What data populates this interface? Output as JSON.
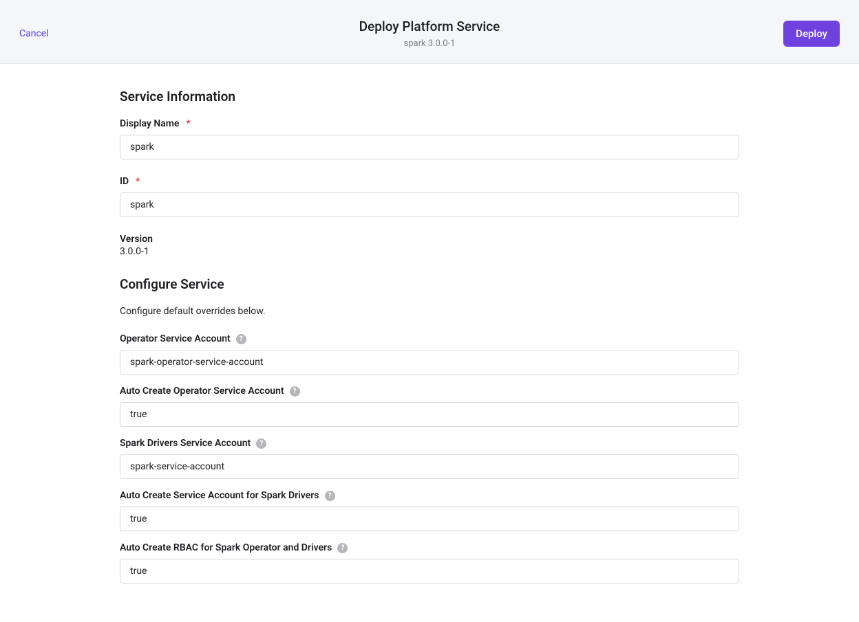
{
  "header": {
    "cancel_label": "Cancel",
    "title": "Deploy Platform Service",
    "subtitle": "spark 3.0.0-1",
    "deploy_label": "Deploy"
  },
  "service_info": {
    "title": "Service Information",
    "display_name": {
      "label": "Display Name",
      "required": "*",
      "value": "spark"
    },
    "id": {
      "label": "ID",
      "required": "*",
      "value": "spark"
    },
    "version": {
      "label": "Version",
      "value": "3.0.0-1"
    }
  },
  "configure": {
    "title": "Configure Service",
    "description": "Configure default overrides below.",
    "fields": [
      {
        "label": "Operator Service Account",
        "value": "spark-operator-service-account"
      },
      {
        "label": "Auto Create Operator Service Account",
        "value": "true"
      },
      {
        "label": "Spark Drivers Service Account",
        "value": "spark-service-account"
      },
      {
        "label": "Auto Create Service Account for Spark Drivers",
        "value": "true"
      },
      {
        "label": "Auto Create RBAC for Spark Operator and Drivers",
        "value": "true"
      }
    ]
  }
}
